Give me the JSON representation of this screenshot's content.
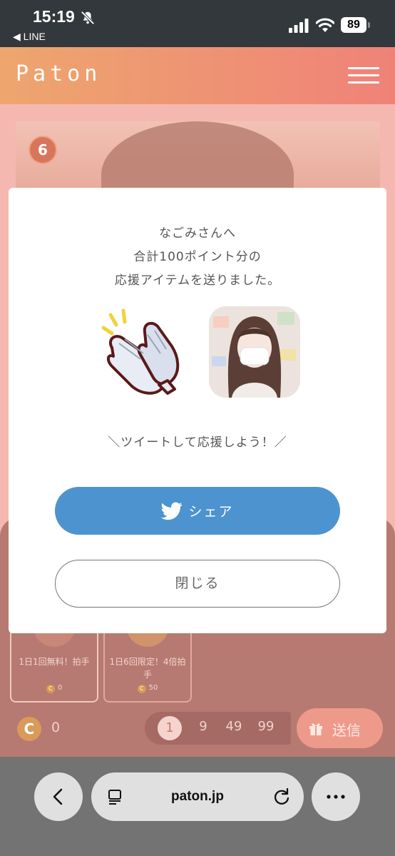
{
  "status_bar": {
    "time": "15:19",
    "back_label": "◀ LINE",
    "battery": "89"
  },
  "header": {
    "logo": "Paton",
    "menu_icon": "hamburger-menu-icon"
  },
  "background": {
    "rank_badge": "6",
    "items": [
      {
        "name": "1日1回無料！拍手",
        "price": "0"
      },
      {
        "name": "1日6回限定！4倍拍手",
        "price": "50"
      }
    ],
    "coin_symbol": "C",
    "coin_balance": "0",
    "quantities": [
      "1",
      "9",
      "49",
      "99"
    ],
    "selected_quantity": "1",
    "send_label": "送信"
  },
  "modal": {
    "line1": "なごみさんへ",
    "line2": "合計100ポイント分の",
    "line3": "応援アイテムを送りました。",
    "tweet_prompt": "＼ツイートして応援しよう！／",
    "share_label": "シェア",
    "close_label": "閉じる"
  },
  "browser": {
    "url": "paton.jp"
  },
  "colors": {
    "accent_blue": "#4d93cf",
    "header_gradient_start": "#eea66e",
    "header_gradient_end": "#ef8278"
  }
}
